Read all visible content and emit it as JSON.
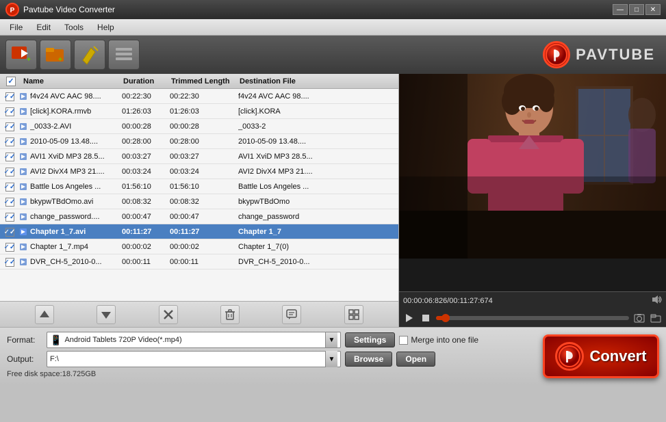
{
  "app": {
    "title": "Pavtube Video Converter",
    "logo_text": "PAVTUBE"
  },
  "menu": {
    "items": [
      "File",
      "Edit",
      "Tools",
      "Help"
    ]
  },
  "toolbar": {
    "buttons": [
      {
        "name": "add-video",
        "icon": "🎬+",
        "label": "Add Video"
      },
      {
        "name": "add-folder",
        "icon": "📁+",
        "label": "Add Folder"
      },
      {
        "name": "edit",
        "icon": "✏️",
        "label": "Edit"
      },
      {
        "name": "list",
        "icon": "☰",
        "label": "List"
      }
    ]
  },
  "file_table": {
    "headers": [
      "",
      "Name",
      "Duration",
      "Trimmed Length",
      "Destination File"
    ],
    "rows": [
      {
        "checked": true,
        "name": "f4v24 AVC AAC 98....",
        "duration": "00:22:30",
        "trimmed": "00:22:30",
        "dest": "f4v24 AVC AAC 98...."
      },
      {
        "checked": true,
        "name": "[click].KORA.rmvb",
        "duration": "01:26:03",
        "trimmed": "01:26:03",
        "dest": "[click].KORA"
      },
      {
        "checked": true,
        "name": "_0033-2.AVI",
        "duration": "00:00:28",
        "trimmed": "00:00:28",
        "dest": "_0033-2"
      },
      {
        "checked": true,
        "name": "2010-05-09 13.48....",
        "duration": "00:28:00",
        "trimmed": "00:28:00",
        "dest": "2010-05-09 13.48...."
      },
      {
        "checked": true,
        "name": "AVI1 XviD MP3 28.5...",
        "duration": "00:03:27",
        "trimmed": "00:03:27",
        "dest": "AVI1 XviD MP3 28.5..."
      },
      {
        "checked": true,
        "name": "AVI2 DivX4 MP3 21....",
        "duration": "00:03:24",
        "trimmed": "00:03:24",
        "dest": "AVI2 DivX4 MP3 21...."
      },
      {
        "checked": true,
        "name": "Battle Los Angeles ...",
        "duration": "01:56:10",
        "trimmed": "01:56:10",
        "dest": "Battle Los Angeles ..."
      },
      {
        "checked": true,
        "name": "bkypwTBdOmo.avi",
        "duration": "00:08:32",
        "trimmed": "00:08:32",
        "dest": "bkypwTBdOmo"
      },
      {
        "checked": true,
        "name": "change_password....",
        "duration": "00:00:47",
        "trimmed": "00:00:47",
        "dest": "change_password"
      },
      {
        "checked": true,
        "name": "Chapter 1_7.avi",
        "duration": "00:11:27",
        "trimmed": "00:11:27",
        "dest": "Chapter 1_7",
        "selected": true
      },
      {
        "checked": true,
        "name": "Chapter 1_7.mp4",
        "duration": "00:00:02",
        "trimmed": "00:00:02",
        "dest": "Chapter 1_7(0)"
      },
      {
        "checked": true,
        "name": "DVR_CH-5_2010-0...",
        "duration": "00:00:11",
        "trimmed": "00:00:11",
        "dest": "DVR_CH-5_2010-0..."
      }
    ]
  },
  "preview": {
    "timecode": "00:00:06:826/00:11:27:674",
    "progress_pct": 1
  },
  "actions": {
    "up_icon": "↑",
    "down_icon": "↓",
    "delete_icon": "✕",
    "trash_icon": "🗑",
    "comment_icon": "💬",
    "grid_icon": "⊞"
  },
  "format": {
    "label": "Format:",
    "value": "Android Tablets 720P Video(*.mp4)",
    "icon": "📱",
    "settings_label": "Settings",
    "merge_label": "Merge into one file"
  },
  "output": {
    "label": "Output:",
    "value": "F:\\"
  },
  "buttons": {
    "browse": "Browse",
    "open": "Open",
    "convert": "Convert"
  },
  "status": {
    "disk_space": "Free disk space:18.725GB"
  },
  "window_controls": {
    "minimize": "—",
    "maximize": "□",
    "close": "✕"
  }
}
